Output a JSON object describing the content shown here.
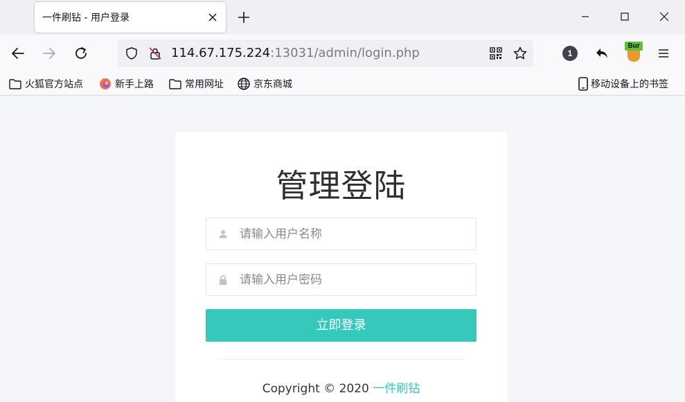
{
  "browser": {
    "tab": {
      "title": "一件刷钻 - 用户登录"
    },
    "url": {
      "host": "114.67.175.224",
      "rest": ":13031/admin/login.php"
    },
    "extension_badge": "1",
    "burp_label": "Bur",
    "bookmarks": [
      {
        "label": "火狐官方站点",
        "icon": "folder-icon"
      },
      {
        "label": "新手上路",
        "icon": "firefox-icon"
      },
      {
        "label": "常用网址",
        "icon": "folder-icon"
      },
      {
        "label": "京东商城",
        "icon": "globe-icon"
      }
    ],
    "mobile_bookmarks": {
      "label": "移动设备上的书签",
      "icon": "mobile-icon"
    }
  },
  "login": {
    "title": "管理登陆",
    "username_placeholder": "请输入用户名称",
    "password_placeholder": "请输入用户密码",
    "submit_label": "立即登录",
    "copyright_prefix": "Copyright © 2020",
    "copyright_link": "一件刷钻"
  },
  "colors": {
    "accent": "#35c9bb",
    "page_background": "#f5f6fa",
    "card_background": "#ffffff",
    "title_text": "#2f2f33"
  }
}
